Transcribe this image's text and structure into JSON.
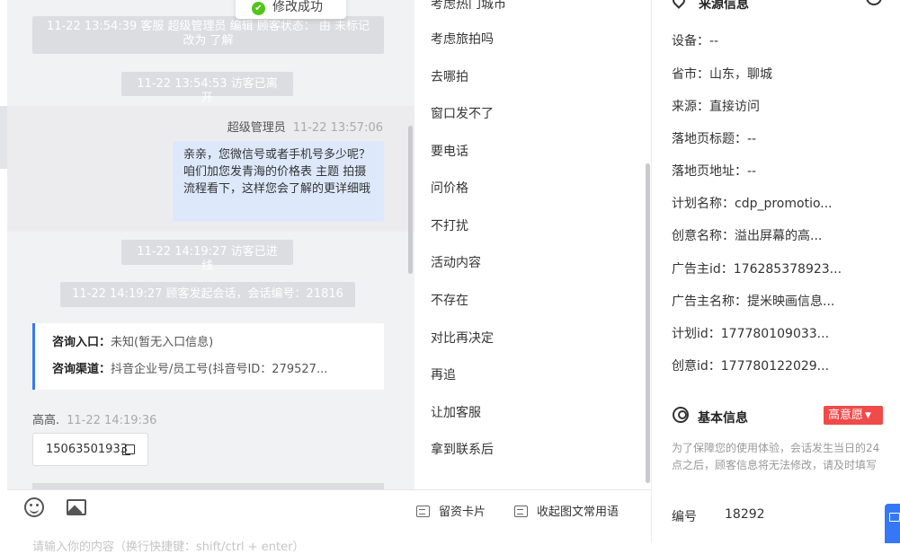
{
  "toast": {
    "text": "修改成功"
  },
  "chat": {
    "system_messages": [
      "11-22 13:54:39 客服 超级管理员 编辑 顾客状态： 由 未标记 改为 了解",
      "11-22 13:54:53 访客已离开",
      "11-22 14:19:27 访客已进线",
      "11-22 14:19:27 顾客发起会话，会话编号：21816"
    ],
    "agent_message": {
      "sender": "超级管理员",
      "time": "11-22 13:57:06",
      "text": "亲亲，您微信号或者手机号多少呢？咱们加您发青海的价格表 主题 拍摄流程看下，这样您会了解的更详细哦"
    },
    "info_card": {
      "entry_label": "咨询入口：",
      "entry_value": "未知(暂无入口信息)",
      "channel_label": "咨询渠道：",
      "channel_value": "抖音企业号/员工号(抖音号ID：279527..."
    },
    "visitor_message": {
      "sender": "高高.",
      "time": "11-22 14:19:36",
      "text": "15063501933"
    }
  },
  "input": {
    "placeholder": "请输入你的内容（换行快捷键：shift/ctrl + enter）",
    "tools": [
      "留资卡片",
      "收起图文常用语"
    ]
  },
  "quick_replies": [
    "考虑热门城市",
    "考虑旅拍吗",
    "去哪拍",
    "窗口发不了",
    "要电话",
    "问价格",
    "不打扰",
    "活动内容",
    "不存在",
    "对比再决定",
    "再追",
    "让加客服",
    "拿到联系后"
  ],
  "source_info": {
    "title": "来源信息",
    "fields": [
      "设备：--",
      "省市：山东，聊城",
      "来源：直接访问",
      "落地页标题：--",
      "落地页地址：--",
      "计划名称：cdp_promotio...",
      "创意名称：溢出屏幕的高...",
      "广告主id：176285378923...",
      "广告主名称：提米映画信息...",
      "计划id：177780109033...",
      "创意id：177780122029..."
    ]
  },
  "basic_info": {
    "title": "基本信息",
    "badge": "高意愿",
    "note": "为了保障您的使用体验，会话发生当日的24点之后，顾客信息将无法修改，请及时填写",
    "id_label": "编号",
    "id_value": "18292"
  }
}
